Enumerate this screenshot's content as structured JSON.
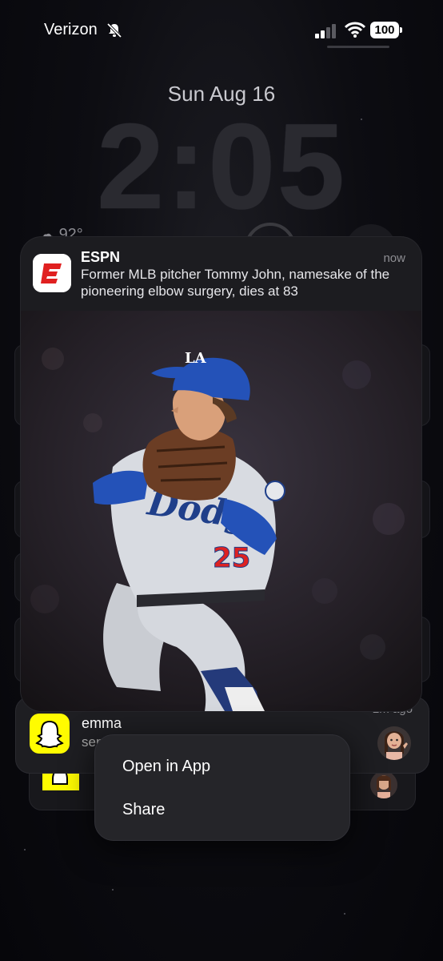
{
  "status_bar": {
    "carrier": "Verizon",
    "battery": "100"
  },
  "lock_screen": {
    "date": "Sun Aug 16",
    "time": "2:05",
    "weather_temp": "92°"
  },
  "espn_notification": {
    "app": "ESPN",
    "time": "now",
    "body": "Former MLB pitcher Tommy John, namesake of the pioneering elbow surgery, dies at 83"
  },
  "snap_notification": {
    "sender": "emma",
    "text": "sent",
    "time": "2m ago"
  },
  "context_menu": {
    "open_label": "Open in App",
    "share_label": "Share"
  },
  "colors": {
    "espn_red": "#e02020",
    "snap_yellow": "#fffc00"
  }
}
